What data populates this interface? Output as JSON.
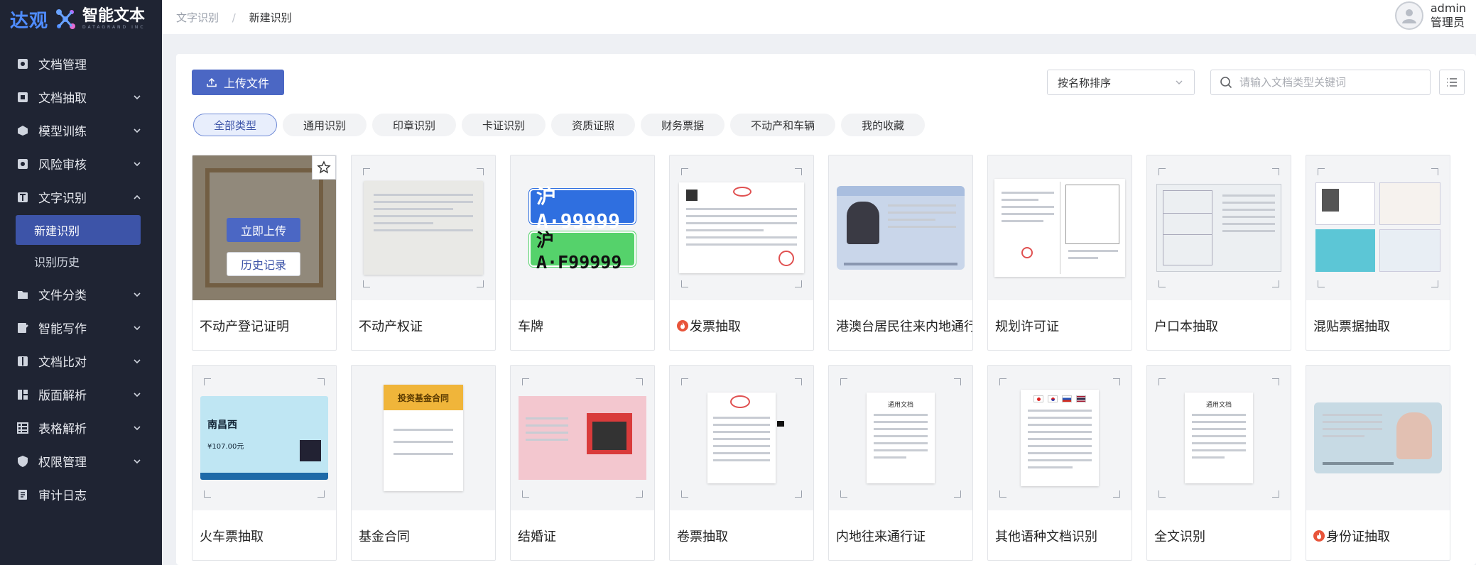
{
  "logo": {
    "brand_cn": "达观",
    "product": "智能文本",
    "product_sub": "DATAGRAND INC"
  },
  "nav": {
    "items": [
      {
        "label": "文档管理",
        "icon": "folder-icon",
        "chevron": "none"
      },
      {
        "label": "文档抽取",
        "icon": "extract-icon",
        "chevron": "down"
      },
      {
        "label": "模型训练",
        "icon": "cube-icon",
        "chevron": "down"
      },
      {
        "label": "风险审核",
        "icon": "audit-icon",
        "chevron": "down"
      },
      {
        "label": "文字识别",
        "icon": "text-icon",
        "chevron": "up"
      }
    ],
    "sub_items": [
      {
        "label": "新建识别",
        "active": true
      },
      {
        "label": "识别历史",
        "active": false
      }
    ],
    "items_after": [
      {
        "label": "文件分类",
        "icon": "classify-icon",
        "chevron": "down"
      },
      {
        "label": "智能写作",
        "icon": "write-icon",
        "chevron": "down"
      },
      {
        "label": "文档比对",
        "icon": "compare-icon",
        "chevron": "down"
      },
      {
        "label": "版面解析",
        "icon": "layout-icon",
        "chevron": "down"
      },
      {
        "label": "表格解析",
        "icon": "table-icon",
        "chevron": "down"
      },
      {
        "label": "权限管理",
        "icon": "shield-icon",
        "chevron": "down"
      },
      {
        "label": "审计日志",
        "icon": "log-icon",
        "chevron": "none"
      }
    ]
  },
  "breadcrumb": {
    "parent": "文字识别",
    "separator": "/",
    "current": "新建识别"
  },
  "user": {
    "name": "admin",
    "role": "管理员"
  },
  "toolbar": {
    "upload_label": "上传文件",
    "sort_value": "按名称排序",
    "search_placeholder": "请输入文档类型关键词"
  },
  "tabs": [
    {
      "label": "全部类型",
      "active": true
    },
    {
      "label": "通用识别",
      "active": false
    },
    {
      "label": "印章识别",
      "active": false
    },
    {
      "label": "卡证识别",
      "active": false
    },
    {
      "label": "资质证照",
      "active": false
    },
    {
      "label": "财务票据",
      "active": false
    },
    {
      "label": "不动产和车辆",
      "active": false
    },
    {
      "label": "我的收藏",
      "active": false
    }
  ],
  "hover_tile": {
    "upload_now": "立即上传",
    "history": "历史记录"
  },
  "thumb_text": {
    "plate1": "沪A·99999",
    "plate2": "沪A·F99999",
    "fund_title": "投资基金合同",
    "general_doc": "通用文档",
    "train_station": "南昌西",
    "train_price": "¥107.00元"
  },
  "tiles": [
    {
      "name": "不动产登记证明",
      "hot": false
    },
    {
      "name": "不动产权证",
      "hot": false
    },
    {
      "name": "车牌",
      "hot": false
    },
    {
      "name": "发票抽取",
      "hot": true
    },
    {
      "name": "港澳台居民往来内地通行证",
      "hot": false
    },
    {
      "name": "规划许可证",
      "hot": false
    },
    {
      "name": "户口本抽取",
      "hot": false
    },
    {
      "name": "混贴票据抽取",
      "hot": false
    },
    {
      "name": "火车票抽取",
      "hot": false
    },
    {
      "name": "基金合同",
      "hot": false
    },
    {
      "name": "结婚证",
      "hot": false
    },
    {
      "name": "卷票抽取",
      "hot": false
    },
    {
      "name": "内地往来通行证",
      "hot": false
    },
    {
      "name": "其他语种文档识别",
      "hot": false
    },
    {
      "name": "全文识别",
      "hot": false
    },
    {
      "name": "身份证抽取",
      "hot": true
    }
  ],
  "colors": {
    "sidebar_bg": "#1f2433",
    "primary": "#4b67c4",
    "hot": "#e8543a"
  }
}
